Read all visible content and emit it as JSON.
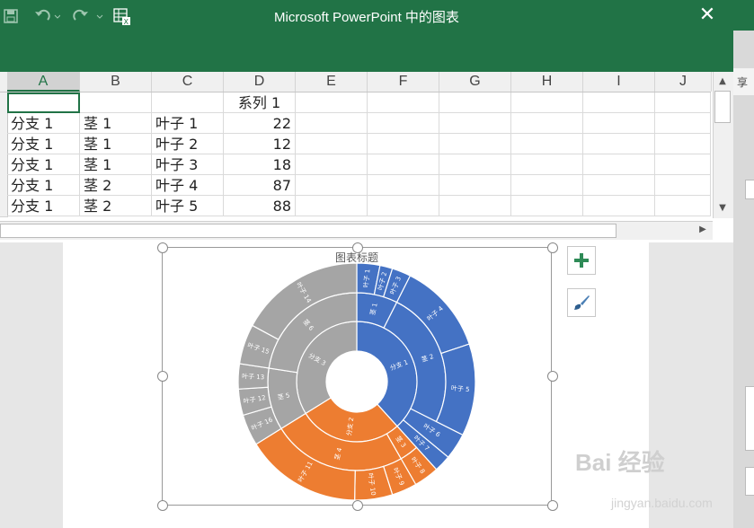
{
  "window": {
    "title": "Microsoft PowerPoint 中的图表",
    "close_glyph": "✕",
    "save_icon": "save-icon",
    "undo_icon": "undo-icon",
    "redo_icon": "redo-icon",
    "excel_icon": "excel-edit-icon"
  },
  "background_ribbon_fragment": "享",
  "sheet": {
    "columns": [
      "A",
      "B",
      "C",
      "D",
      "E",
      "F",
      "G",
      "H",
      "I",
      "J"
    ],
    "header_row": [
      "",
      "",
      "",
      "系列 1"
    ],
    "rows": [
      [
        "分支 1",
        "茎 1",
        "叶子 1",
        "22"
      ],
      [
        "分支 1",
        "茎 1",
        "叶子 2",
        "12"
      ],
      [
        "分支 1",
        "茎 1",
        "叶子 3",
        "18"
      ],
      [
        "分支 1",
        "茎 2",
        "叶子 4",
        "87"
      ],
      [
        "分支 1",
        "茎 2",
        "叶子 5",
        "88"
      ]
    ]
  },
  "chart_panel": {
    "add_icon": "plus-icon",
    "style_icon": "paintbrush-icon"
  },
  "watermark": {
    "text": "Bai 经验",
    "sub": "jingyan.baidu.com"
  },
  "chart_data": {
    "type": "sunburst",
    "title": "图表标题",
    "colors": {
      "分支 1": "#4472C4",
      "分支 2": "#ED7D31",
      "分支 3": "#A5A5A5"
    },
    "branches": [
      {
        "name": "分支 1",
        "stems": [
          {
            "name": "茎 1",
            "leaves": [
              {
                "name": "叶子 1",
                "value": 22
              },
              {
                "name": "叶子 2",
                "value": 12
              },
              {
                "name": "叶子 3",
                "value": 18
              }
            ]
          },
          {
            "name": "茎 2",
            "leaves": [
              {
                "name": "叶子 4",
                "value": 87
              },
              {
                "name": "叶子 5",
                "value": 88
              }
            ]
          },
          {
            "name": "",
            "leaves": [
              {
                "name": "叶子 6",
                "value": 25
              }
            ]
          },
          {
            "name": "",
            "leaves": [
              {
                "name": "叶子 7",
                "value": 16
              }
            ]
          }
        ]
      },
      {
        "name": "分支 2",
        "stems": [
          {
            "name": "茎 3",
            "leaves": [
              {
                "name": "叶子 8",
                "value": 24
              }
            ]
          },
          {
            "name": "茎 4",
            "leaves": [
              {
                "name": "叶子 9",
                "value": 24
              },
              {
                "name": "叶子 10",
                "value": 36
              },
              {
                "name": "叶子 11",
                "value": 111
              }
            ]
          }
        ]
      },
      {
        "name": "分支 3",
        "stems": [
          {
            "name": "茎 5",
            "leaves": [
              {
                "name": "叶子 16",
                "value": 30
              },
              {
                "name": "叶子 12",
                "value": 25
              },
              {
                "name": "叶子 13",
                "value": 24
              }
            ]
          },
          {
            "name": "茎 6",
            "leaves": [
              {
                "name": "叶子 15",
                "value": 38
              },
              {
                "name": "叶子 14",
                "value": 120
              }
            ]
          }
        ]
      }
    ]
  }
}
